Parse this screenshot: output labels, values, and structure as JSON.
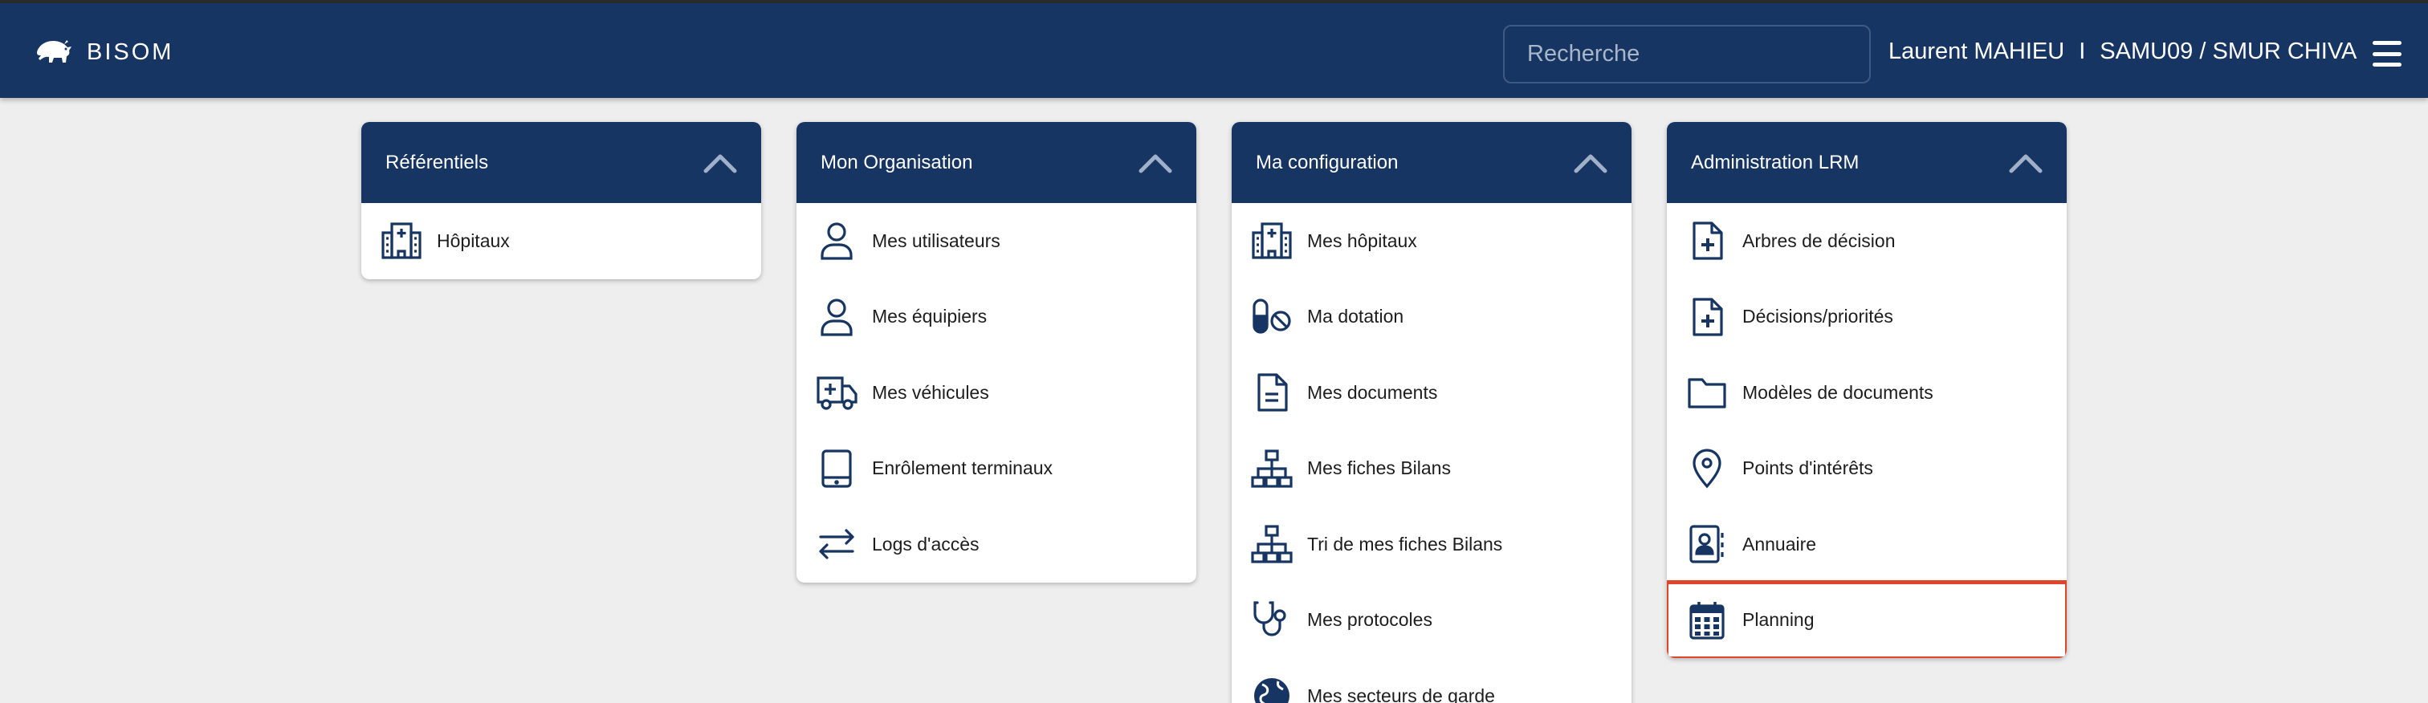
{
  "header": {
    "brand": "BISOM",
    "search_placeholder": "Recherche",
    "user_name": "Laurent MAHIEU",
    "separator": "I",
    "organization": "SAMU09 / SMUR CHIVA"
  },
  "cards": [
    {
      "title": "Référentiels",
      "items": [
        {
          "label": "Hôpitaux",
          "icon": "hospital-icon"
        }
      ]
    },
    {
      "title": "Mon Organisation",
      "items": [
        {
          "label": "Mes utilisateurs",
          "icon": "user-icon"
        },
        {
          "label": "Mes équipiers",
          "icon": "user-icon"
        },
        {
          "label": "Mes véhicules",
          "icon": "ambulance-icon"
        },
        {
          "label": "Enrôlement terminaux",
          "icon": "tablet-icon"
        },
        {
          "label": "Logs d'accès",
          "icon": "arrows-exchange-icon"
        }
      ]
    },
    {
      "title": "Ma configuration",
      "items": [
        {
          "label": "Mes hôpitaux",
          "icon": "hospital-icon"
        },
        {
          "label": "Ma dotation",
          "icon": "pill-ban-icon"
        },
        {
          "label": "Mes documents",
          "icon": "document-icon"
        },
        {
          "label": "Mes fiches Bilans",
          "icon": "sitemap-icon"
        },
        {
          "label": "Tri de mes fiches Bilans",
          "icon": "sitemap-icon"
        },
        {
          "label": "Mes protocoles",
          "icon": "stethoscope-icon"
        },
        {
          "label": "Mes secteurs de garde",
          "icon": "globe-icon"
        }
      ]
    },
    {
      "title": "Administration LRM",
      "items": [
        {
          "label": "Arbres de décision",
          "icon": "file-medical-icon"
        },
        {
          "label": "Décisions/priorités",
          "icon": "file-medical-icon"
        },
        {
          "label": "Modèles de documents",
          "icon": "folder-icon"
        },
        {
          "label": "Points d'intérêts",
          "icon": "map-pin-icon"
        },
        {
          "label": "Annuaire",
          "icon": "address-book-icon"
        },
        {
          "label": "Planning",
          "icon": "calendar-icon",
          "highlighted": true
        }
      ]
    }
  ],
  "colors": {
    "header_bg": "#173562",
    "page_bg": "#eeeeee",
    "highlight": "#e0442b",
    "icon": "#173562"
  }
}
